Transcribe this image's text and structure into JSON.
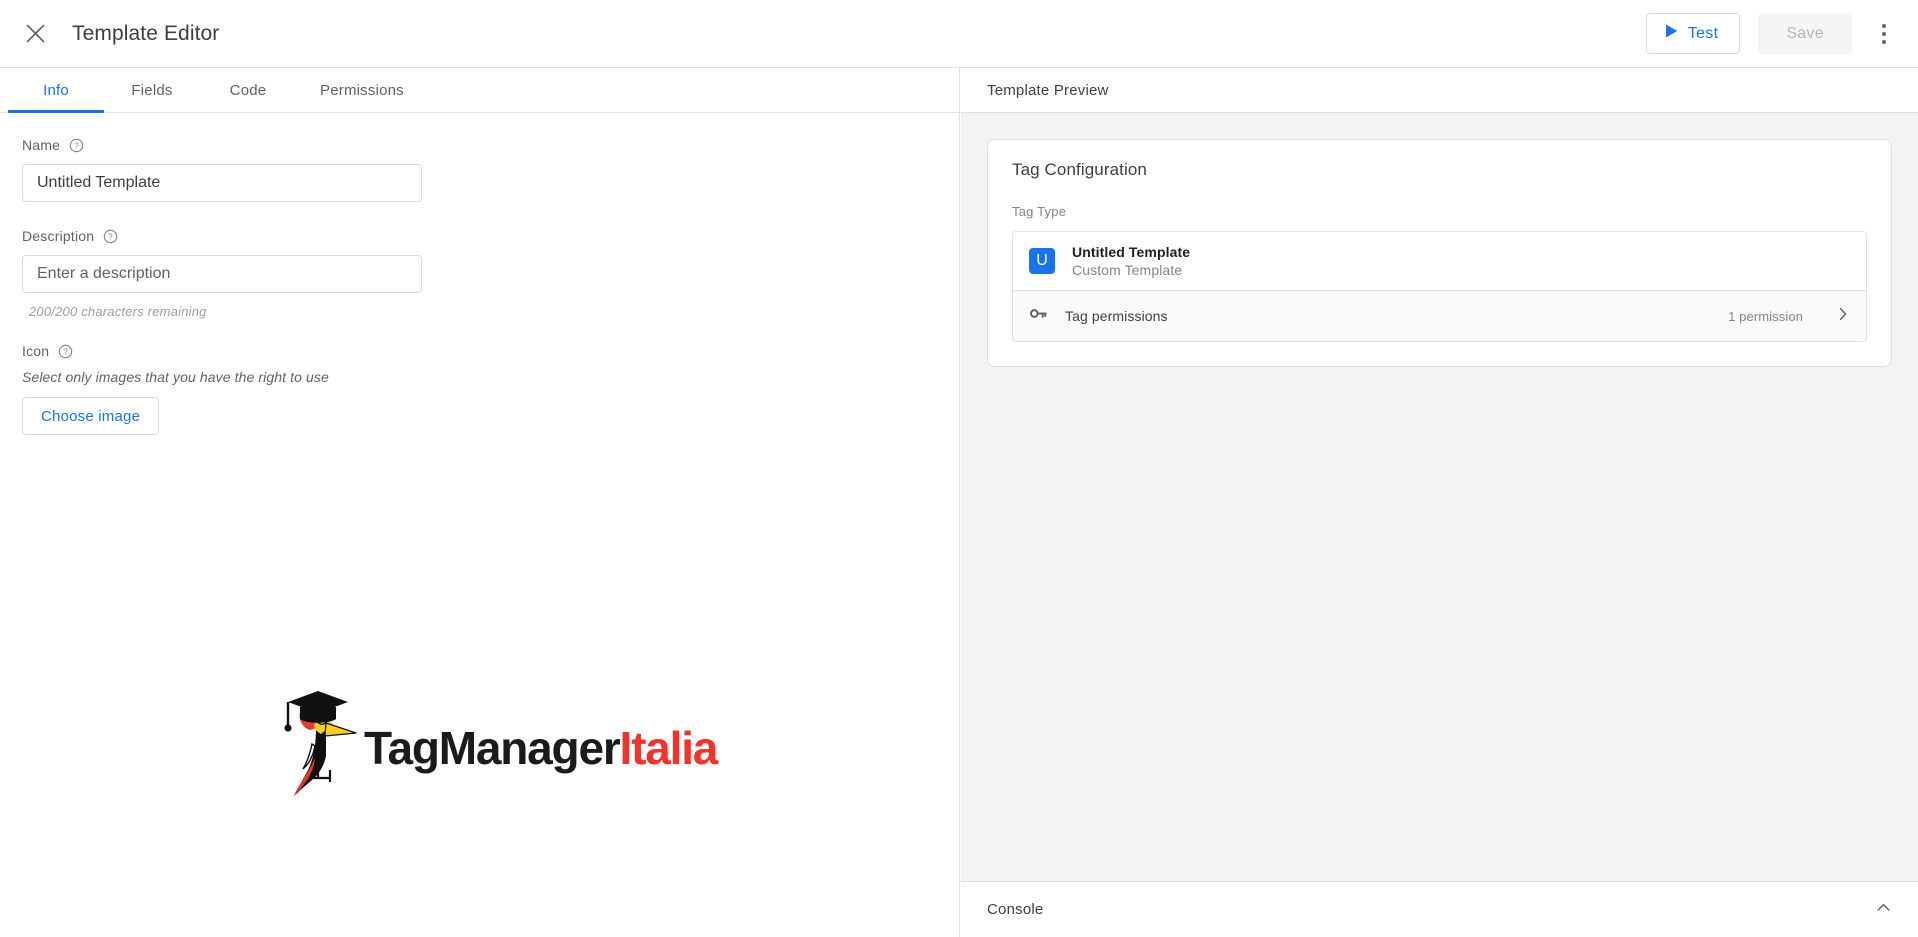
{
  "topbar": {
    "close_icon": "close-icon",
    "title": "Template Editor",
    "test_label": "Test",
    "test_icon": "play-icon",
    "save_label": "Save",
    "more_icon": "more-vert-icon",
    "accent_color": "#1a73e8",
    "disabled_color": "#b4b4b4"
  },
  "tabs": [
    {
      "label": "Info",
      "active": true
    },
    {
      "label": "Fields",
      "active": false
    },
    {
      "label": "Code",
      "active": false
    },
    {
      "label": "Permissions",
      "active": false
    }
  ],
  "form": {
    "name": {
      "label": "Name",
      "help_icon": "help-circle-icon",
      "value": "Untitled Template",
      "placeholder": "Untitled Template"
    },
    "description": {
      "label": "Description",
      "help_icon": "help-circle-icon",
      "value": "",
      "placeholder": "Enter a description",
      "counter": "200/200 characters remaining"
    },
    "icon": {
      "label": "Icon",
      "help_icon": "help-circle-icon",
      "hint": "Select only images that you have the right to use",
      "button_label": "Choose image"
    }
  },
  "logo": {
    "icon": "woodpecker-graduate-icon",
    "text_primary": "TagManager",
    "text_secondary": "Italia",
    "primary_color": "#1b1b1b",
    "secondary_color": "#f0342b"
  },
  "preview": {
    "header": "Template Preview",
    "card_title": "Tag Configuration",
    "tag_type_label": "Tag Type",
    "tag_type": {
      "icon_letter": "U",
      "icon_color": "#1a73e8",
      "name": "Untitled Template",
      "subtitle": "Custom Template"
    },
    "permissions_row": {
      "icon": "key-icon",
      "label": "Tag permissions",
      "count": "1 permission",
      "chevron_icon": "chevron-right-icon"
    }
  },
  "console": {
    "label": "Console",
    "chevron_icon": "chevron-up-icon"
  }
}
